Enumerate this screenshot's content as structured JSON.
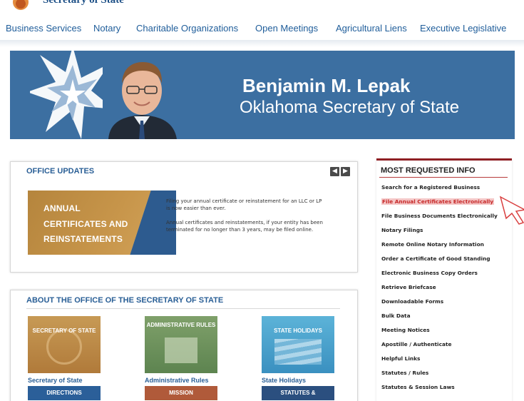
{
  "header": {
    "site_title": "Secretary of State"
  },
  "nav": {
    "items": [
      {
        "label": "Business Services"
      },
      {
        "label": "Notary"
      },
      {
        "label": "Charitable Organizations"
      },
      {
        "label": "Open Meetings"
      },
      {
        "label": "Agricultural Liens"
      },
      {
        "label": "Executive Legislative"
      }
    ]
  },
  "banner": {
    "name": "Benjamin M. Lepak",
    "title": "Oklahoma Secretary of State"
  },
  "office_updates": {
    "heading": "OFFICE UPDATES",
    "prev_icon": "chevron-left-icon",
    "next_icon": "chevron-right-icon",
    "card_lines": [
      "ANNUAL",
      "CERTIFICATES AND",
      "REINSTATEMENTS"
    ],
    "text_1": "Filing your annual certificate or reinstatement for an LLC or LP is now easier than ever.",
    "text_2": "Annual certificates and reinstatements, if your entity has been terminated for no longer than 3 years, may be filed online."
  },
  "about": {
    "heading": "ABOUT THE OFFICE OF THE SECRETARY OF STATE",
    "tiles": [
      {
        "label": "SECRETARY OF STATE",
        "caption": "Secretary of State"
      },
      {
        "label": "ADMINISTRATIVE RULES",
        "caption": "Administrative Rules"
      },
      {
        "label": "STATE HOLIDAYS",
        "caption": "State Holidays"
      }
    ],
    "lower_tiles": [
      {
        "label": "DIRECTIONS"
      },
      {
        "label": "MISSION"
      },
      {
        "label": "STATUTES &"
      }
    ]
  },
  "most_requested": {
    "heading": "MOST REQUESTED INFO",
    "links": [
      {
        "label": "Search for a Registered Business"
      },
      {
        "label": "File Annual Certificates Electronically",
        "highlighted": true
      },
      {
        "label": "File Business Documents Electronically"
      },
      {
        "label": "Notary Filings"
      },
      {
        "label": "Remote Online Notary Information"
      },
      {
        "label": "Order a Certificate of Good Standing"
      },
      {
        "label": "Electronic Business Copy Orders"
      },
      {
        "label": "Retrieve Briefcase"
      },
      {
        "label": "Downloadable Forms"
      },
      {
        "label": "Bulk Data"
      },
      {
        "label": "Meeting Notices"
      },
      {
        "label": "Apostille / Authenticate"
      },
      {
        "label": "Helpful Links"
      },
      {
        "label": "Statutes / Rules"
      },
      {
        "label": "Statutes & Session Laws"
      }
    ]
  },
  "colors": {
    "banner_blue": "#3c6fa1",
    "link_blue": "#2a5f96",
    "accent_red": "#8f1f24",
    "highlight": "#f4c6c6"
  }
}
